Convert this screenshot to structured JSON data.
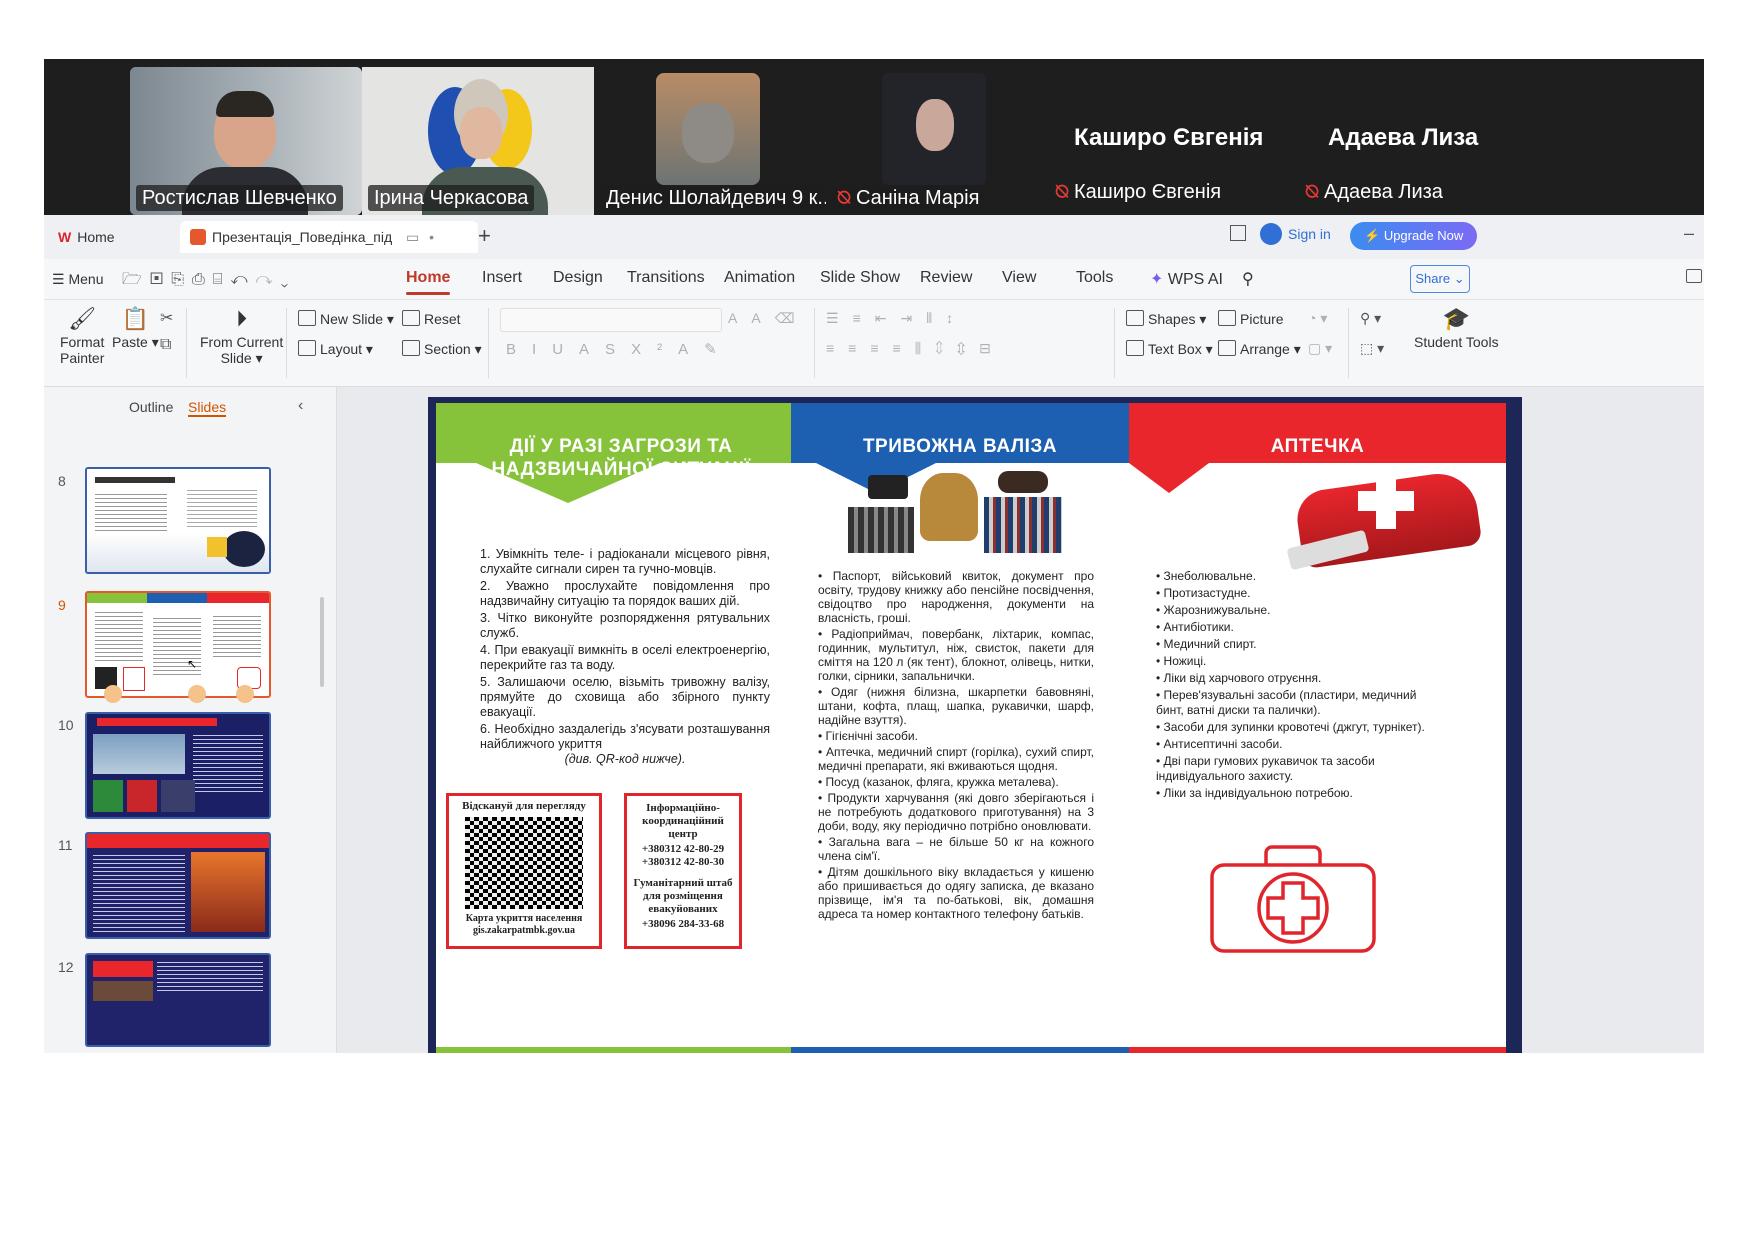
{
  "participants": [
    {
      "name": "Ростислав Шевченко",
      "muted": false,
      "active": true
    },
    {
      "name": "Ірина Черкасова",
      "muted": false
    },
    {
      "name": "Денис Шолайдевич 9 к...",
      "muted": false
    },
    {
      "name": "Саніна Марія",
      "muted": true
    },
    {
      "name": "Каширо Євгенія",
      "muted": true,
      "big": "Каширо Євгенія"
    },
    {
      "name": "Адаева Лиза",
      "muted": true,
      "big": "Адаева Лиза"
    }
  ],
  "tabs": {
    "home": "Home",
    "doc": "Презентація_Поведінка_під"
  },
  "titlebar": {
    "sign_in": "Sign in",
    "upgrade": "Upgrade Now"
  },
  "menubar": {
    "menu": "Menu",
    "items": [
      "Home",
      "Insert",
      "Design",
      "Transitions",
      "Animation",
      "Slide Show",
      "Review",
      "View",
      "Tools"
    ],
    "wps_ai": "WPS AI",
    "share": "Share"
  },
  "ribbon": {
    "format_painter": "Format Painter",
    "format_painter_l1": "Format",
    "format_painter_l2": "Painter",
    "paste": "Paste",
    "from_current_l1": "From Current",
    "from_current_l2": "Slide",
    "new_slide": "New  Slide",
    "layout": "Layout",
    "reset": "Reset",
    "section": "Section",
    "shapes": "Shapes",
    "picture": "Picture",
    "text_box": "Text Box",
    "arrange": "Arrange",
    "student_tools": "Student Tools"
  },
  "leftpanel": {
    "outline": "Outline",
    "slides": "Slides",
    "thumbs": [
      "8",
      "9",
      "10",
      "11",
      "12"
    ]
  },
  "slide": {
    "h1": "ДІЇ У РАЗІ ЗАГРОЗИ ТА НАДЗВИЧАЙНОЇ СИТУАЦІЇ",
    "h2": "ТРИВОЖНА  ВАЛІЗА",
    "h3": "АПТЕЧКА",
    "col1": [
      "1. Увімкніть теле- і радіоканали місцевого рівня, слухайте сигнали сирен та гучно-мовців.",
      "2. Уважно прослухайте повідомлення про надзвичайну ситуацію та порядок ваших дій.",
      "3. Чітко виконуйте розпорядження рятувальних служб.",
      "4. При евакуації вимкніть в оселі електроенергію, перекрийте газ та воду.",
      "5. Залишаючи оселю, візьміть тривожну валізу, прямуйте до сховища або збірного пункту евакуації.",
      "6. Необхідно заздалегідь з'ясувати розташування найближчого укриття",
      "(див. QR-код нижче)."
    ],
    "box1_top": "Відскануй для перегляду",
    "box1_bottom": "Карта укриття населення gis.zakarpatmbk.gov.ua",
    "box2": [
      "Інформаційно-координаційний центр",
      "+380312 42-80-29",
      "+380312 42-80-30",
      "Гуманітарний штаб для розміщення евакуйованих",
      "+38096 284-33-68"
    ],
    "col2": [
      "• Паспорт, військовий квиток, документ про освіту, трудову книжку або пенсійне посвідчення, свідоцтво про народження, документи на власність, гроші.",
      "• Радіоприймач, повербанк, ліхтарик, компас, годинник, мультитул, ніж, свисток, пакети для сміття на 120 л (як тент), блокнот, олівець, нитки, голки, сірники, запальнички.",
      "• Одяг (нижня білизна, шкарпетки бавовняні, штани, кофта, плащ, шапка, рукавички, шарф, надійне взуття).",
      "• Гігієнічні засоби.",
      "• Аптечка, медичний спирт (горілка), сухий спирт, медичні препарати, які вживаються щодня.",
      "• Посуд (казанок, фляга, кружка металева).",
      "• Продукти харчування (які довго зберігаються і не потребують додаткового приготування) на 3 доби, воду, яку періодично потрібно оновлювати.",
      "• Загальна вага – не більше 50 кг на кожного члена сім'ї.",
      "• Дітям дошкільного віку вкладається у кишеню або пришивається до одягу записка, де вказано прізвище, ім'я та по-батькові, вік, домашня адреса та номер контактного телефону батьків."
    ],
    "col3": [
      "• Знеболювальне.",
      "• Протизастудне.",
      "• Жарознижувальне.",
      "• Антибіотики.",
      "• Медичний спирт.",
      "• Ножиці.",
      "• Ліки від харчового отруєння.",
      "• Перев'язувальні засоби (пластири, медичний бинт, ватні диски та палички).",
      "• Засоби для зупинки кровотечі (джгут, турнікет).",
      "• Антисептичні засоби.",
      "• Дві пари гумових рукавичок та засоби індивідуального захисту.",
      "• Ліки за індивідуальною потребою."
    ]
  },
  "colors": {
    "green": "#86c33b",
    "blue": "#1d5fb0",
    "red": "#e8262c",
    "accent": "#c0392b",
    "active_speaker": "#2ecc71"
  }
}
